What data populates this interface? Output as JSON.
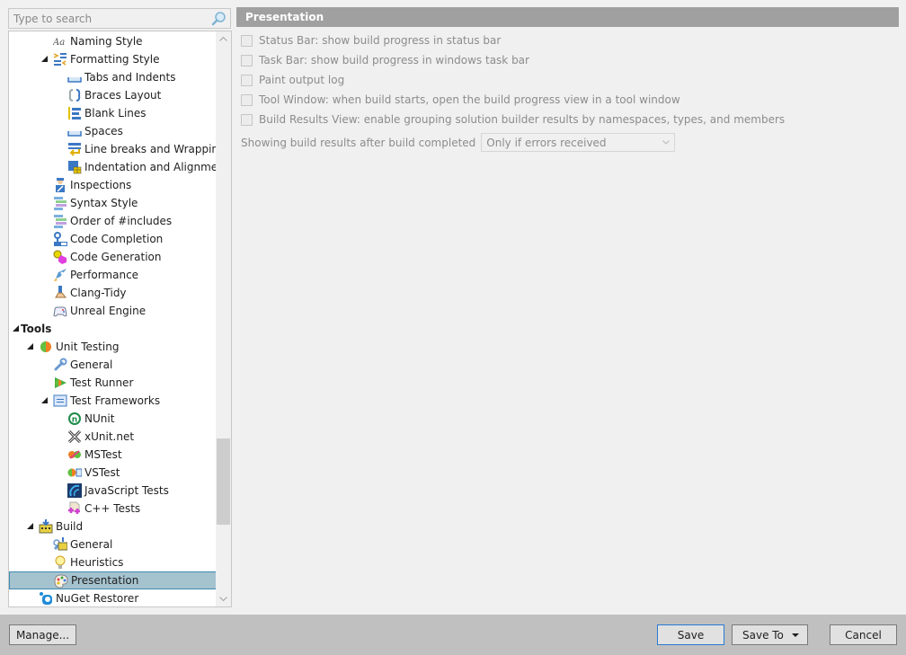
{
  "search": {
    "placeholder": "Type to search",
    "value": ""
  },
  "tree": {
    "items": [
      {
        "label": "Naming Style",
        "icon": "naming-style-icon",
        "level": 3,
        "expander": ""
      },
      {
        "label": "Formatting Style",
        "icon": "formatting-style-icon",
        "level": 3,
        "expander": "expanded"
      },
      {
        "label": "Tabs and Indents",
        "icon": "tabs-indents-icon",
        "level": 4,
        "expander": ""
      },
      {
        "label": "Braces Layout",
        "icon": "braces-layout-icon",
        "level": 4,
        "expander": ""
      },
      {
        "label": "Blank Lines",
        "icon": "blank-lines-icon",
        "level": 4,
        "expander": ""
      },
      {
        "label": "Spaces",
        "icon": "spaces-icon",
        "level": 4,
        "expander": ""
      },
      {
        "label": "Line breaks and Wrapping",
        "icon": "line-breaks-icon",
        "level": 4,
        "expander": ""
      },
      {
        "label": "Indentation and Alignment",
        "icon": "indentation-icon",
        "level": 4,
        "expander": ""
      },
      {
        "label": "Inspections",
        "icon": "inspections-icon",
        "level": 3,
        "expander": ""
      },
      {
        "label": "Syntax Style",
        "icon": "syntax-style-icon",
        "level": 3,
        "expander": ""
      },
      {
        "label": "Order of #includes",
        "icon": "order-includes-icon",
        "level": 3,
        "expander": ""
      },
      {
        "label": "Code Completion",
        "icon": "code-completion-icon",
        "level": 3,
        "expander": ""
      },
      {
        "label": "Code Generation",
        "icon": "code-generation-icon",
        "level": 3,
        "expander": ""
      },
      {
        "label": "Performance",
        "icon": "rocket-icon",
        "level": 3,
        "expander": ""
      },
      {
        "label": "Clang-Tidy",
        "icon": "clang-tidy-icon",
        "level": 3,
        "expander": ""
      },
      {
        "label": "Unreal Engine",
        "icon": "gamepad-icon",
        "level": 3,
        "expander": ""
      },
      {
        "label": "Tools",
        "icon": "",
        "level": 1,
        "expander": "expanded",
        "bold": true
      },
      {
        "label": "Unit Testing",
        "icon": "unit-testing-icon",
        "level": 2,
        "expander": "expanded"
      },
      {
        "label": "General",
        "icon": "wrench-icon",
        "level": 3,
        "expander": ""
      },
      {
        "label": "Test Runner",
        "icon": "test-runner-icon",
        "level": 3,
        "expander": ""
      },
      {
        "label": "Test Frameworks",
        "icon": "test-frameworks-icon",
        "level": 3,
        "expander": "expanded"
      },
      {
        "label": "NUnit",
        "icon": "nunit-icon",
        "level": 4,
        "expander": ""
      },
      {
        "label": "xUnit.net",
        "icon": "xunit-icon",
        "level": 4,
        "expander": ""
      },
      {
        "label": "MSTest",
        "icon": "mstest-icon",
        "level": 4,
        "expander": ""
      },
      {
        "label": "VSTest",
        "icon": "vstest-icon",
        "level": 4,
        "expander": ""
      },
      {
        "label": "JavaScript Tests",
        "icon": "javascript-tests-icon",
        "level": 4,
        "expander": ""
      },
      {
        "label": "C++ Tests",
        "icon": "cpp-tests-icon",
        "level": 4,
        "expander": ""
      },
      {
        "label": "Build",
        "icon": "build-icon",
        "level": 2,
        "expander": "expanded"
      },
      {
        "label": "General",
        "icon": "build-general-icon",
        "level": 3,
        "expander": ""
      },
      {
        "label": "Heuristics",
        "icon": "lightbulb-icon",
        "level": 3,
        "expander": ""
      },
      {
        "label": "Presentation",
        "icon": "palette-icon",
        "level": 3,
        "expander": "",
        "selected": true
      },
      {
        "label": "NuGet Restorer",
        "icon": "nuget-icon",
        "level": 2,
        "expander": ""
      }
    ]
  },
  "page": {
    "title": "Presentation",
    "options": [
      {
        "label": "Status Bar: show build progress in status bar",
        "checked": false
      },
      {
        "label": "Task Bar: show build progress in windows task bar",
        "checked": false
      },
      {
        "label": "Paint output log",
        "checked": false
      },
      {
        "label": "Tool Window: when build starts, open the build progress view in a tool window",
        "checked": false
      },
      {
        "label": "Build Results View: enable grouping solution builder results by namespaces, types, and members",
        "checked": false
      }
    ],
    "showing_label": "Showing build results after build completed",
    "showing_value": "Only if errors received"
  },
  "footer": {
    "manage_label": "Manage...",
    "save_label": "Save",
    "save_to_label": "Save To",
    "cancel_label": "Cancel"
  },
  "colors": {
    "header_bg": "#a0a0a0",
    "selection_bg": "#a5c3cf",
    "selection_border": "#3d8ab0",
    "default_button_border": "#2a7ad2",
    "footer_bg": "#c0c0c0"
  }
}
